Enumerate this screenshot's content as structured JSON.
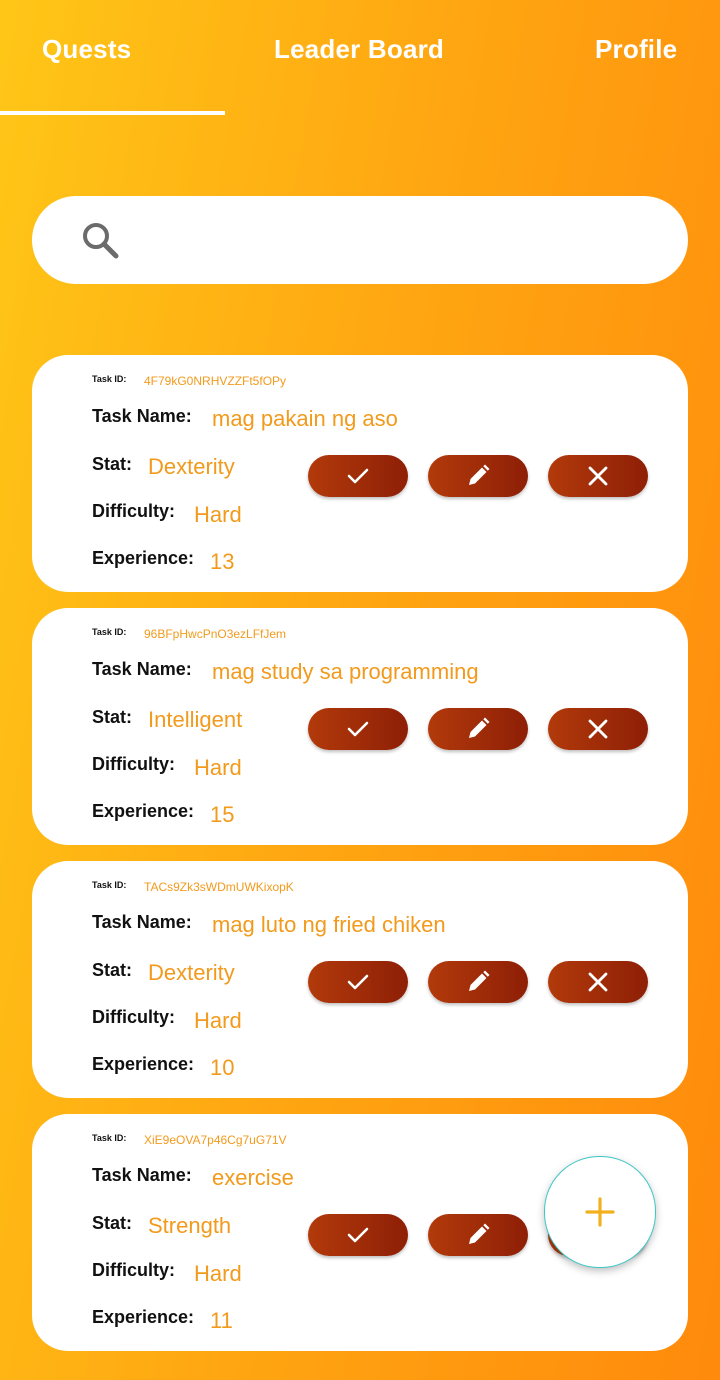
{
  "tabs": [
    {
      "label": "Quests",
      "active": true
    },
    {
      "label": "Leader Board",
      "active": false
    },
    {
      "label": "Profile",
      "active": false
    }
  ],
  "search": {
    "placeholder": "",
    "value": "",
    "icon": "search-icon"
  },
  "labels": {
    "task_id": "Task ID:",
    "task_name": "Task Name:",
    "stat": "Stat:",
    "difficulty": "Difficulty:",
    "experience": "Experience:"
  },
  "actions": {
    "complete_icon": "check-icon",
    "edit_icon": "pencil-icon",
    "delete_icon": "close-icon"
  },
  "quests": [
    {
      "task_id": "4F79kG0NRHVZZFt5fOPy",
      "task_name": "mag pakain ng aso",
      "stat": "Dexterity",
      "difficulty": "Hard",
      "experience": "13"
    },
    {
      "task_id": "96BFpHwcPnO3ezLFfJem",
      "task_name": "mag study sa programming",
      "stat": "Intelligent",
      "difficulty": "Hard",
      "experience": "15"
    },
    {
      "task_id": "TACs9Zk3sWDmUWKixopK",
      "task_name": "mag luto ng fried chiken",
      "stat": "Dexterity",
      "difficulty": "Hard",
      "experience": "10"
    },
    {
      "task_id": "XiE9eOVA7p46Cg7uG71V",
      "task_name": "exercise",
      "stat": "Strength",
      "difficulty": "Hard",
      "experience": "11"
    }
  ],
  "fab": {
    "icon": "plus-icon"
  },
  "colors": {
    "accent": "#F29A1C",
    "button": "#A12C08",
    "background_start": "#FFC617",
    "background_end": "#FF8A0C"
  }
}
